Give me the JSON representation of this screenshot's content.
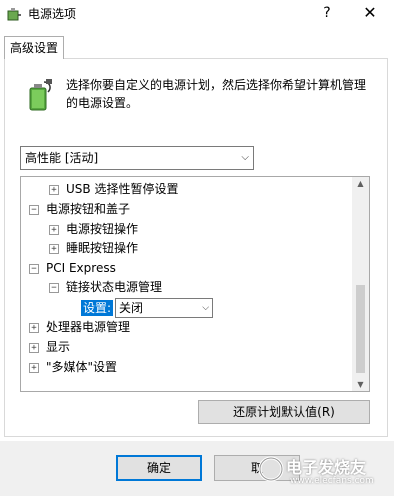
{
  "window": {
    "title": "电源选项",
    "help_symbol": "?",
    "close_symbol": "✕"
  },
  "tab": {
    "label": "高级设置"
  },
  "description": "选择你要自定义的电源计划，然后选择你希望计算机管理的电源设置。",
  "plan_select": {
    "value": "高性能 [活动]",
    "arrow": "⌵"
  },
  "tree": {
    "items": [
      {
        "pm": "+",
        "label": "USB 选择性暂停设置"
      },
      {
        "pm": "−",
        "label": "电源按钮和盖子"
      },
      {
        "pm": "+",
        "label": "电源按钮操作"
      },
      {
        "pm": "+",
        "label": "睡眠按钮操作"
      },
      {
        "pm": "−",
        "label": "PCI Express"
      },
      {
        "pm": "−",
        "label": "链接状态电源管理"
      },
      {
        "pm": "+",
        "label": "处理器电源管理"
      },
      {
        "pm": "+",
        "label": "显示"
      },
      {
        "pm": "+",
        "label": "\"多媒体\"设置"
      }
    ],
    "setting": {
      "label": "设置:",
      "value": "关闭",
      "arrow": "⌵"
    },
    "scroll_up": "▲",
    "scroll_down": "▼"
  },
  "buttons": {
    "restore": "还原计划默认值(R)",
    "ok": "确定",
    "cancel": "取"
  },
  "watermark": {
    "text": "电子发烧友",
    "url": "www.elecfans.com"
  },
  "colors": {
    "accent": "#0078d7",
    "footer": "#f0f0f0",
    "button": "#e1e1e1"
  },
  "icons": {
    "app": "power-options-icon",
    "battery": "battery-plug-icon"
  }
}
